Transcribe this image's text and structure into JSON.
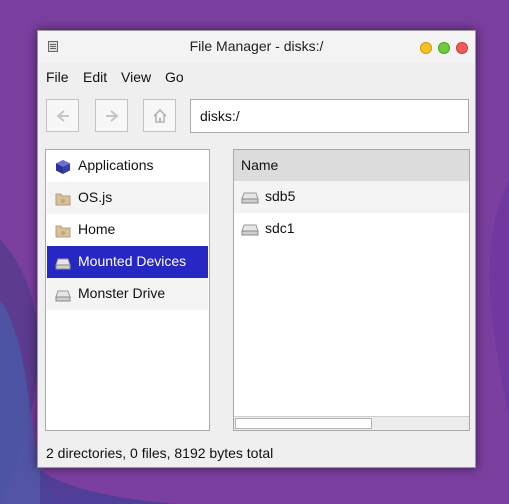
{
  "window": {
    "title": "File Manager - disks:/"
  },
  "menu": [
    "File",
    "Edit",
    "View",
    "Go"
  ],
  "toolbar": {
    "back_icon": "arrow-left-icon",
    "forward_icon": "arrow-right-icon",
    "home_icon": "home-icon"
  },
  "address": {
    "value": "disks:/"
  },
  "sidebar": {
    "items": [
      {
        "label": "Applications",
        "icon": "cube-icon"
      },
      {
        "label": "OS.js",
        "icon": "folder-icon"
      },
      {
        "label": "Home",
        "icon": "folder-icon"
      },
      {
        "label": "Mounted Devices",
        "icon": "drive-icon",
        "selected": true
      },
      {
        "label": "Monster Drive",
        "icon": "drive-icon"
      }
    ]
  },
  "filelist": {
    "column_name": "Name",
    "rows": [
      {
        "label": "sdb5",
        "icon": "drive-icon"
      },
      {
        "label": "sdc1",
        "icon": "drive-icon"
      }
    ]
  },
  "status": {
    "text": "2 directories, 0 files, 8192 bytes total"
  },
  "colors": {
    "desktop": "#7b3fa0",
    "selection": "#2727c4"
  }
}
